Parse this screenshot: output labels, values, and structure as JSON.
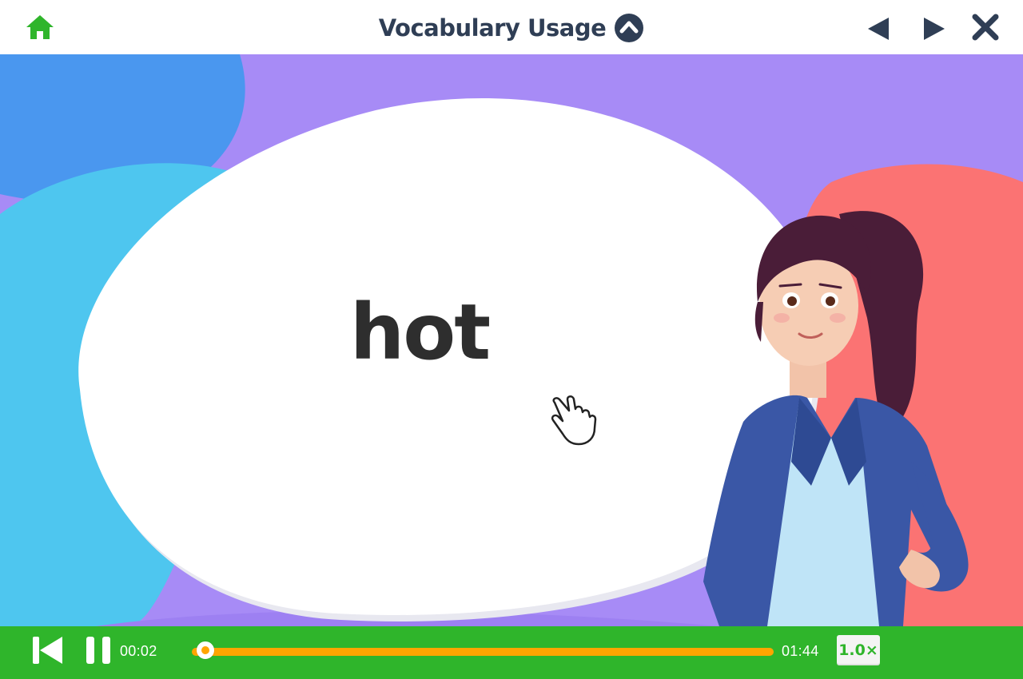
{
  "header": {
    "title": "Vocabulary Usage",
    "home_icon": "home-icon",
    "collapse_icon": "chevron-up-circle-icon",
    "prev_icon": "triangle-left-icon",
    "next_icon": "triangle-right-icon",
    "close_icon": "close-x-icon"
  },
  "stage": {
    "word": "hot",
    "character": "teacher",
    "cursor_icon": "hand-pointer-icon"
  },
  "player": {
    "current_time": "00:02",
    "total_time": "01:44",
    "progress": 0.02,
    "speed": "1.0×",
    "restart_icon": "skip-back-icon",
    "pause_icon": "pause-icon"
  },
  "colors": {
    "header_bg": "#ffffff",
    "title_text": "#2f3e55",
    "home_green": "#2fb52b",
    "control_bar": "#2fb52b",
    "progress_track": "#ffa500",
    "stage_purple": "#a78bf6",
    "blob_blue": "#4a97ef",
    "blob_cyan": "#4ec6ef",
    "blob_coral": "#fb7373"
  }
}
